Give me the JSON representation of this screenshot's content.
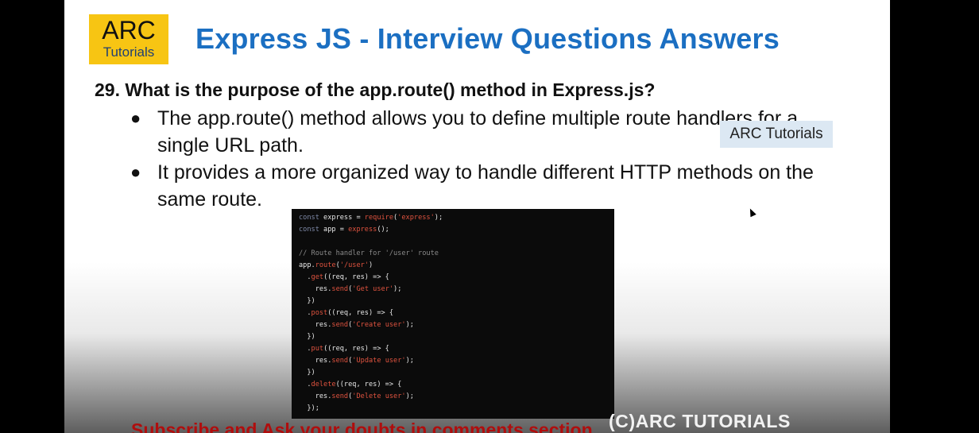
{
  "slide": {
    "logo": {
      "main": "ARC",
      "sub": "Tutorials"
    },
    "title": "Express JS - Interview Questions Answers",
    "question": "29. What is the purpose of the app.route() method in Express.js?",
    "bullets": [
      {
        "line1": "The app.route() method allows you to define multiple route handlers for a",
        "line2": "single URL path."
      },
      {
        "line1": "It provides a more organized way to handle different HTTP methods on the",
        "line2": "same route."
      }
    ],
    "bullet_glyph": "●",
    "overlay_badge": "ARC Tutorials",
    "footer_cta": "Subscribe and Ask your doubts in comments section",
    "copyright": "(C)ARC TUTORIALS"
  },
  "code": {
    "lines": [
      [
        {
          "t": "const ",
          "c": "kw"
        },
        {
          "t": "express = ",
          "c": ""
        },
        {
          "t": "require",
          "c": "fn"
        },
        {
          "t": "(",
          "c": ""
        },
        {
          "t": "'express'",
          "c": "str"
        },
        {
          "t": ");",
          "c": ""
        }
      ],
      [
        {
          "t": "const ",
          "c": "kw"
        },
        {
          "t": "app = ",
          "c": ""
        },
        {
          "t": "express",
          "c": "fn"
        },
        {
          "t": "();",
          "c": ""
        }
      ],
      [],
      [
        {
          "t": "// Route handler for '/user' route",
          "c": "cm"
        }
      ],
      [
        {
          "t": "app.",
          "c": ""
        },
        {
          "t": "route",
          "c": "fn"
        },
        {
          "t": "(",
          "c": ""
        },
        {
          "t": "'/user'",
          "c": "str"
        },
        {
          "t": ")",
          "c": ""
        }
      ],
      [
        {
          "t": "  .",
          "c": ""
        },
        {
          "t": "get",
          "c": "fn"
        },
        {
          "t": "((req, res) => {",
          "c": ""
        }
      ],
      [
        {
          "t": "    res.",
          "c": ""
        },
        {
          "t": "send",
          "c": "fn"
        },
        {
          "t": "(",
          "c": ""
        },
        {
          "t": "'Get user'",
          "c": "str"
        },
        {
          "t": ");",
          "c": ""
        }
      ],
      [
        {
          "t": "  })",
          "c": ""
        }
      ],
      [
        {
          "t": "  .",
          "c": ""
        },
        {
          "t": "post",
          "c": "fn"
        },
        {
          "t": "((req, res) => {",
          "c": ""
        }
      ],
      [
        {
          "t": "    res.",
          "c": ""
        },
        {
          "t": "send",
          "c": "fn"
        },
        {
          "t": "(",
          "c": ""
        },
        {
          "t": "'Create user'",
          "c": "str"
        },
        {
          "t": ");",
          "c": ""
        }
      ],
      [
        {
          "t": "  })",
          "c": ""
        }
      ],
      [
        {
          "t": "  .",
          "c": ""
        },
        {
          "t": "put",
          "c": "fn"
        },
        {
          "t": "((req, res) => {",
          "c": ""
        }
      ],
      [
        {
          "t": "    res.",
          "c": ""
        },
        {
          "t": "send",
          "c": "fn"
        },
        {
          "t": "(",
          "c": ""
        },
        {
          "t": "'Update user'",
          "c": "str"
        },
        {
          "t": ");",
          "c": ""
        }
      ],
      [
        {
          "t": "  })",
          "c": ""
        }
      ],
      [
        {
          "t": "  .",
          "c": ""
        },
        {
          "t": "delete",
          "c": "fn"
        },
        {
          "t": "((req, res) => {",
          "c": ""
        }
      ],
      [
        {
          "t": "    res.",
          "c": ""
        },
        {
          "t": "send",
          "c": "fn"
        },
        {
          "t": "(",
          "c": ""
        },
        {
          "t": "'Delete user'",
          "c": "str"
        },
        {
          "t": ");",
          "c": ""
        }
      ],
      [
        {
          "t": "  });",
          "c": ""
        }
      ]
    ]
  },
  "colors": {
    "title_blue": "#1b6fc2",
    "logo_yellow": "#f7c513",
    "cta_red": "#b00d0d",
    "code_bg": "#0b0b0b"
  },
  "icons": {
    "cursor": "mouse-pointer-icon",
    "bullet": "bullet-dot-icon"
  }
}
